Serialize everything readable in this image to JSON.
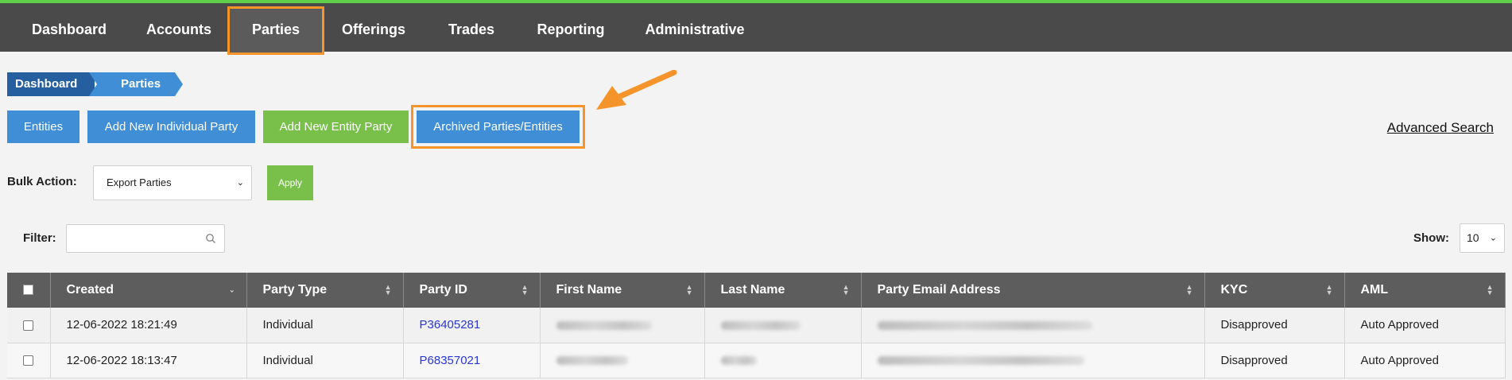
{
  "nav": {
    "items": [
      "Dashboard",
      "Accounts",
      "Parties",
      "Offerings",
      "Trades",
      "Reporting",
      "Administrative"
    ],
    "active": "Parties"
  },
  "breadcrumb": [
    "Dashboard",
    "Parties"
  ],
  "actions": {
    "entities": "Entities",
    "add_individual": "Add New Individual Party",
    "add_entity": "Add New Entity Party",
    "archived": "Archived Parties/Entities",
    "advanced_search": "Advanced Search"
  },
  "bulk": {
    "label": "Bulk Action:",
    "selected": "Export Parties",
    "apply": "Apply"
  },
  "filter": {
    "label": "Filter:",
    "value": ""
  },
  "show": {
    "label": "Show:",
    "selected": "10"
  },
  "table": {
    "columns": [
      "Created",
      "Party Type",
      "Party ID",
      "First Name",
      "Last Name",
      "Party Email Address",
      "KYC",
      "AML"
    ],
    "rows": [
      {
        "created": "12-06-2022 18:21:49",
        "party_type": "Individual",
        "party_id": "P36405281",
        "kyc": "Disapproved",
        "aml": "Auto Approved"
      },
      {
        "created": "12-06-2022 18:13:47",
        "party_type": "Individual",
        "party_id": "P68357021",
        "kyc": "Disapproved",
        "aml": "Auto Approved"
      }
    ]
  },
  "colors": {
    "nav_bg": "#4a4a4a",
    "nav_top": "#5fcf4a",
    "primary": "#3f8ed6",
    "success": "#78c04a",
    "highlight": "#f5942a",
    "link": "#2a36d6"
  },
  "icons": {
    "search": "search-icon",
    "chevron": "chevron-down-icon",
    "arrow": "annotation-arrow-icon"
  }
}
